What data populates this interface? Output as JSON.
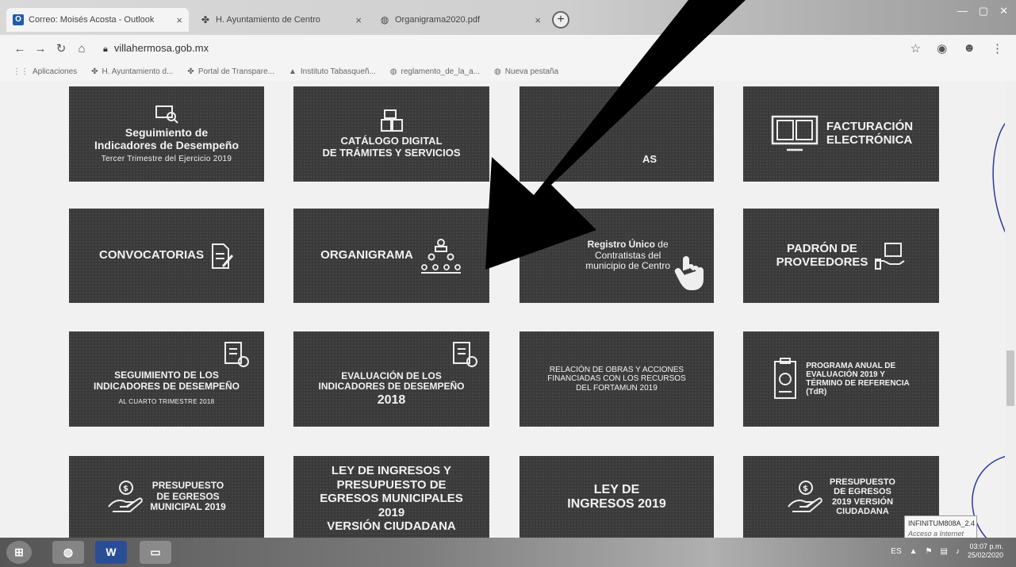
{
  "browser": {
    "tabs": [
      {
        "label": "Correo: Moisés Acosta - Outlook",
        "icon": "outlook-icon",
        "close": "×"
      },
      {
        "label": "H. Ayuntamiento de Centro",
        "icon": "ayuntamiento-icon",
        "close": "×"
      },
      {
        "label": "Organigrama2020.pdf",
        "icon": "globe-icon",
        "close": "×"
      }
    ],
    "new_tab": "+",
    "url": "villahermosa.gob.mx",
    "bookmarks": [
      {
        "label": "Aplicaciones",
        "icon": "apps-grid-icon"
      },
      {
        "label": "H. Ayuntamiento d...",
        "icon": "ayuntamiento-icon"
      },
      {
        "label": "Portal de Transpare...",
        "icon": "ayuntamiento-icon"
      },
      {
        "label": "Instituto Tabasqueñ...",
        "icon": "institute-icon"
      },
      {
        "label": "reglamento_de_la_a...",
        "icon": "globe-icon"
      },
      {
        "label": "Nueva pestaña",
        "icon": "globe-icon"
      }
    ]
  },
  "tiles": {
    "seguimiento_2019": {
      "title": "Seguimiento de\nIndicadores de Desempeño",
      "subtitle": "Tercer Trimestre del Ejercicio 2019"
    },
    "catalogo": {
      "title": "CATÁLOGO DIGITAL\nDE TRÁMITES Y SERVICIOS"
    },
    "hidden_tile": {
      "title": "AS"
    },
    "facturacion": {
      "title": "FACTURACIÓN\nELECTRÓNICA"
    },
    "convocatorias": {
      "title": "CONVOCATORIAS"
    },
    "organigrama": {
      "title": "ORGANIGRAMA"
    },
    "registro": {
      "bold": "Registro Único",
      "rest": " de\nContratistas del\nmunicipio de Centro"
    },
    "padron": {
      "title": "PADRÓN DE\nPROVEEDORES"
    },
    "seguimiento_2018": {
      "title": "SEGUIMIENTO DE LOS\nINDICADORES DE DESEMPEÑO",
      "subtitle": "AL CUARTO TRIMESTRE 2018"
    },
    "evaluacion": {
      "title": "EVALUACIÓN DE LOS\nINDICADORES DE DESEMPEÑO",
      "year": "2018"
    },
    "relacion": {
      "title": "RELACIÓN DE OBRAS Y ACCIONES\nFINANCIADAS CON LOS RECURSOS\nDEL FORTAMUN 2019"
    },
    "programa": {
      "title": "PROGRAMA ANUAL DE\nEVALUACIÓN 2019 Y\nTÉRMINO DE REFERENCIA\n(TdR)"
    },
    "presupuesto": {
      "title": "PRESUPUESTO\nDE EGRESOS\nMUNICIPAL 2019"
    },
    "ley_presupuesto": {
      "title": "LEY DE INGRESOS Y\nPRESUPUESTO DE\nEGRESOS MUNICIPALES\n2019\nVERSIÓN CIUDADANA"
    },
    "ley_ingresos": {
      "title": "LEY DE\nINGRESOS 2019"
    },
    "presupuesto_ciudadana": {
      "title": "PRESUPUESTO\nDE EGRESOS\n2019 VERSIÓN\nCIUDADANA"
    }
  },
  "taskbar": {
    "word_label": "W",
    "lang": "ES",
    "time": "03:07 p.m.",
    "date": "25/02/2020"
  },
  "network_tooltip": {
    "ssid": "INFINITUM808A_2.4",
    "status": "Acceso a Internet"
  },
  "colors": {
    "tile_bg": "#3a3a3a",
    "tile_text": "#f2f2f2",
    "arrow": "#000000"
  }
}
